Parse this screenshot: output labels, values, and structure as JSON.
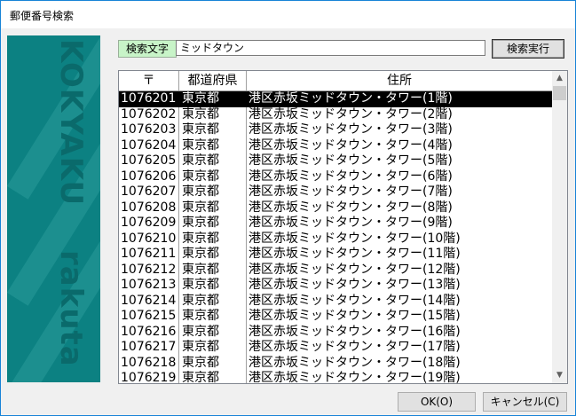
{
  "window": {
    "title": "郵便番号検索"
  },
  "side_panel": {
    "words": [
      "KOKYAKU",
      "rakuta"
    ]
  },
  "search": {
    "label": "検索文字",
    "value": "ミッドタウン",
    "button_label": "検索実行"
  },
  "table": {
    "headers": [
      "〒",
      "都道府県",
      "住所"
    ],
    "rows": [
      {
        "zip": "1076201",
        "pref": "東京都",
        "addr": "港区赤坂ミッドタウン・タワー(1階)",
        "selected": true
      },
      {
        "zip": "1076202",
        "pref": "東京都",
        "addr": "港区赤坂ミッドタウン・タワー(2階)"
      },
      {
        "zip": "1076203",
        "pref": "東京都",
        "addr": "港区赤坂ミッドタウン・タワー(3階)"
      },
      {
        "zip": "1076204",
        "pref": "東京都",
        "addr": "港区赤坂ミッドタウン・タワー(4階)"
      },
      {
        "zip": "1076205",
        "pref": "東京都",
        "addr": "港区赤坂ミッドタウン・タワー(5階)"
      },
      {
        "zip": "1076206",
        "pref": "東京都",
        "addr": "港区赤坂ミッドタウン・タワー(6階)"
      },
      {
        "zip": "1076207",
        "pref": "東京都",
        "addr": "港区赤坂ミッドタウン・タワー(7階)"
      },
      {
        "zip": "1076208",
        "pref": "東京都",
        "addr": "港区赤坂ミッドタウン・タワー(8階)"
      },
      {
        "zip": "1076209",
        "pref": "東京都",
        "addr": "港区赤坂ミッドタウン・タワー(9階)"
      },
      {
        "zip": "1076210",
        "pref": "東京都",
        "addr": "港区赤坂ミッドタウン・タワー(10階)"
      },
      {
        "zip": "1076211",
        "pref": "東京都",
        "addr": "港区赤坂ミッドタウン・タワー(11階)"
      },
      {
        "zip": "1076212",
        "pref": "東京都",
        "addr": "港区赤坂ミッドタウン・タワー(12階)"
      },
      {
        "zip": "1076213",
        "pref": "東京都",
        "addr": "港区赤坂ミッドタウン・タワー(13階)"
      },
      {
        "zip": "1076214",
        "pref": "東京都",
        "addr": "港区赤坂ミッドタウン・タワー(14階)"
      },
      {
        "zip": "1076215",
        "pref": "東京都",
        "addr": "港区赤坂ミッドタウン・タワー(15階)"
      },
      {
        "zip": "1076216",
        "pref": "東京都",
        "addr": "港区赤坂ミッドタウン・タワー(16階)"
      },
      {
        "zip": "1076217",
        "pref": "東京都",
        "addr": "港区赤坂ミッドタウン・タワー(17階)"
      },
      {
        "zip": "1076218",
        "pref": "東京都",
        "addr": "港区赤坂ミッドタウン・タワー(18階)"
      },
      {
        "zip": "1076219",
        "pref": "東京都",
        "addr": "港区赤坂ミッドタウン・タワー(19階)"
      }
    ]
  },
  "scrollbar": {
    "up_icon": "▲",
    "down_icon": "▼"
  },
  "footer": {
    "ok_label": "OK(O)",
    "cancel_label": "キャンセル(C)"
  },
  "colors": {
    "side_panel": "#0c8182",
    "label_bg": "#c8f4c8",
    "selection": "#000000",
    "window_border": "#1883d7"
  }
}
